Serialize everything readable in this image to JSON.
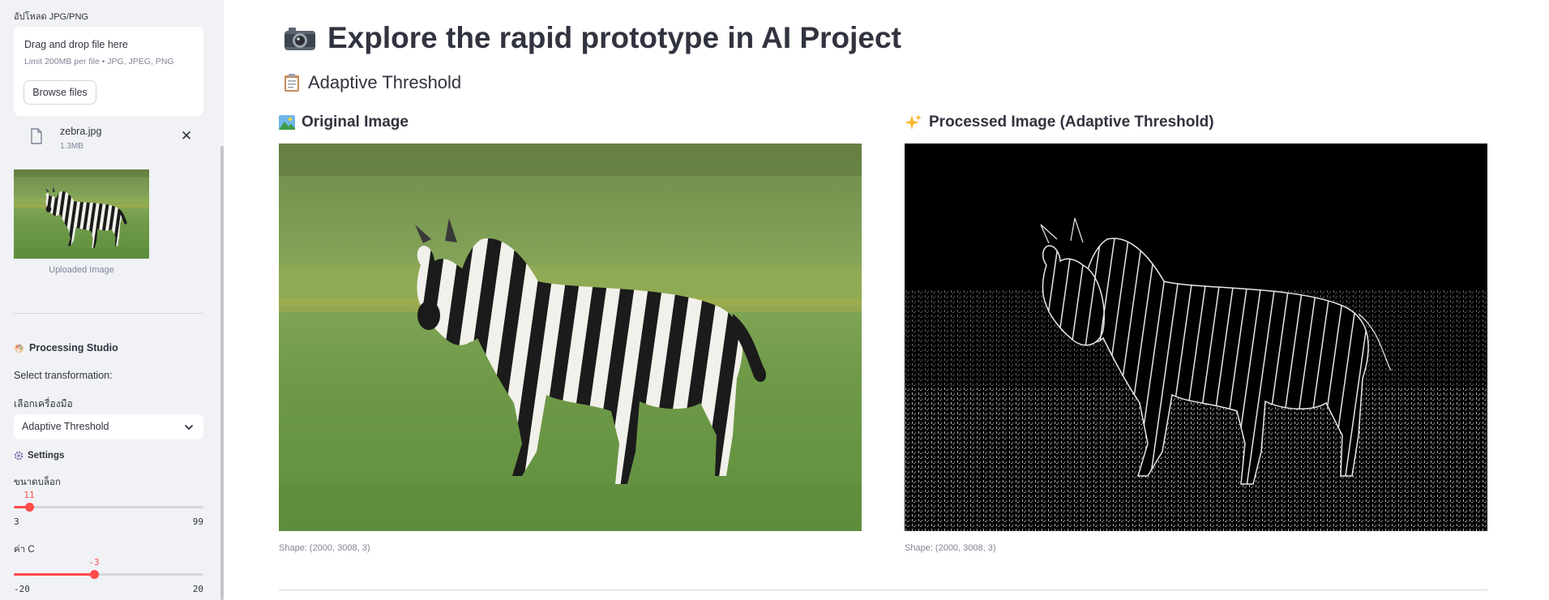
{
  "sidebar": {
    "upload_label": "อัปโหลด JPG/PNG",
    "dropzone_title": "Drag and drop file here",
    "dropzone_limit": "Limit 200MB per file • JPG, JPEG, PNG",
    "browse_label": "Browse files",
    "file": {
      "name": "zebra.jpg",
      "size": "1.3MB",
      "icon": "file-icon"
    },
    "thumbnail_caption": "Uploaded Image",
    "studio_title": "Processing Studio",
    "select_transformation": "Select transformation:",
    "tool_label": "เลือกเครื่องมือ",
    "tool_value": "Adaptive Threshold",
    "settings_title": "Settings",
    "block_size": {
      "label": "ขนาดบล็อก",
      "value": "11",
      "min": "3",
      "max": "99",
      "fraction": 0.0833
    },
    "c_value": {
      "label": "ค่า C",
      "value": "-3",
      "min": "-20",
      "max": "20",
      "fraction": 0.425
    }
  },
  "main": {
    "title": "Explore the rapid prototype in AI Project",
    "subheader": "Adaptive Threshold",
    "original_title": "Original Image",
    "processed_title": "Processed Image (Adaptive Threshold)",
    "original_caption": "Shape: (2000, 3008, 3)",
    "processed_caption": "Shape: (2000, 3008, 3)"
  },
  "colors": {
    "accent": "#ff4b4b",
    "sidebar_bg": "#f0f2f6",
    "text": "#31333f",
    "muted": "#808495"
  }
}
